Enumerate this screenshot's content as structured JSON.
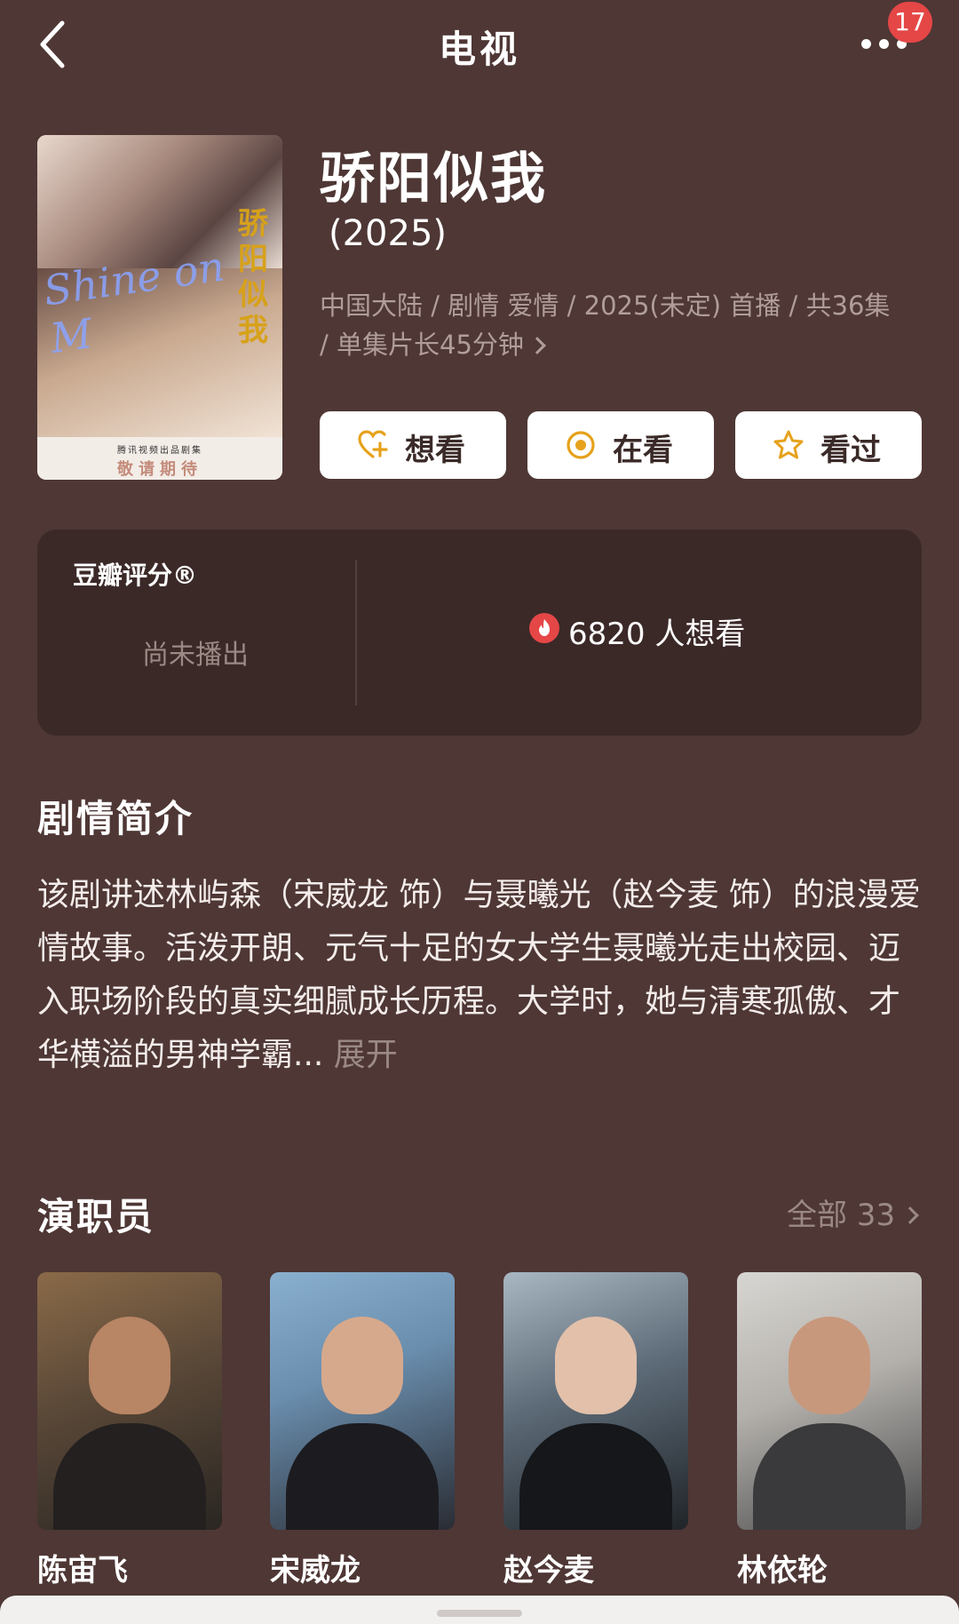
{
  "nav": {
    "title": "电视",
    "badge_count": "17"
  },
  "show": {
    "title": "骄阳似我",
    "year": "(2025)",
    "meta": "中国大陆 / 剧情 爱情 / 2025(未定) 首播 / 共36集 / 单集片长45分钟",
    "poster": {
      "script_text": "Shine on M",
      "calligraphy": "骄阳似我",
      "strip_small": "腾讯视频出品剧集",
      "strip_big": "敬请期待"
    }
  },
  "actions": [
    {
      "label": "想看",
      "icon": "heart-plus-icon"
    },
    {
      "label": "在看",
      "icon": "circle-dot-icon"
    },
    {
      "label": "看过",
      "icon": "star-icon"
    }
  ],
  "rating": {
    "label": "豆瓣评分®",
    "status": "尚未播出",
    "want_count_text": "6820 人想看"
  },
  "summary": {
    "title": "剧情简介",
    "text": "该剧讲述林屿森（宋威龙 饰）与聂曦光（赵今麦 饰）的浪漫爱情故事。活泼开朗、元气十足的女大学生聂曦光走出校园、迈入职场阶段的真实细腻成长历程。大学时，她与清寒孤傲、才华横溢的男神学霸...",
    "expand": "展开"
  },
  "cast": {
    "title": "演职员",
    "all_label": "全部 33",
    "members": [
      {
        "name": "陈宙飞"
      },
      {
        "name": "宋威龙"
      },
      {
        "name": "赵今麦"
      },
      {
        "name": "林依轮"
      }
    ]
  },
  "colors": {
    "background": "#4e3735",
    "card": "#3b2928",
    "muted_text": "#b09d99",
    "button_bg": "#ffffff",
    "icon_accent": "#e6a21b",
    "badge": "#e54646"
  }
}
